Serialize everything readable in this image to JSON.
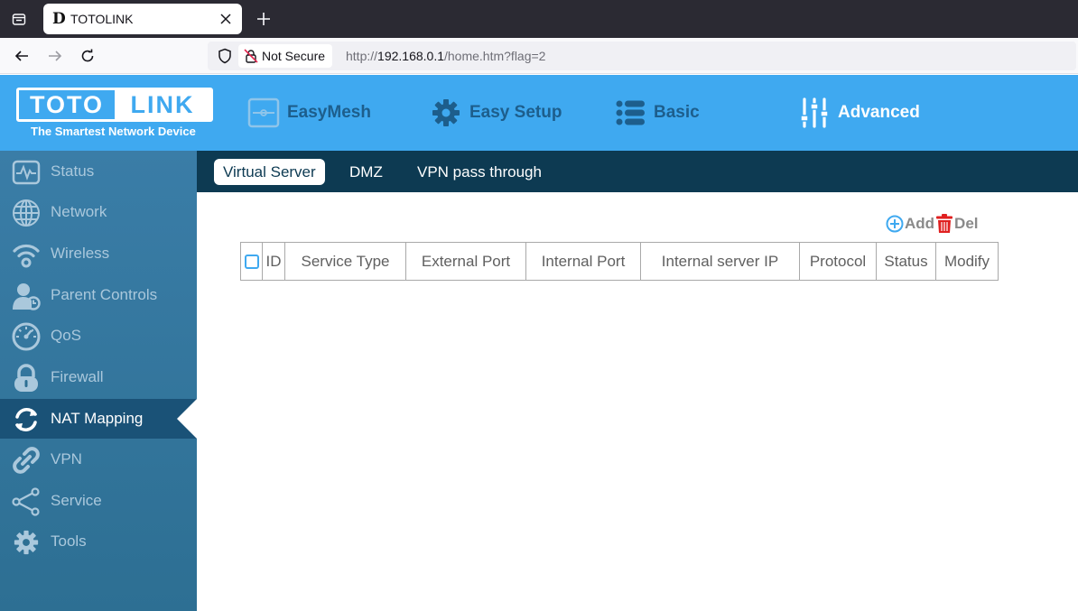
{
  "browser": {
    "tab_title": "TOTOLINK",
    "tab_favicon": "D",
    "security_label": "Not Secure",
    "url_prefix": "http://",
    "url_host": "192.168.0.1",
    "url_path": "/home.htm?flag=2"
  },
  "header": {
    "logo_left": "TOTO",
    "logo_right": "LINK",
    "tagline": "The Smartest Network Device",
    "nav": [
      {
        "label": "EasyMesh",
        "icon": "router-icon"
      },
      {
        "label": "Easy Setup",
        "icon": "gear-icon"
      },
      {
        "label": "Basic",
        "icon": "list-icon"
      },
      {
        "label": "Advanced",
        "icon": "sliders-icon"
      }
    ],
    "active_nav": "Advanced"
  },
  "sidebar": {
    "items": [
      {
        "label": "Status",
        "icon": "pulse-icon"
      },
      {
        "label": "Network",
        "icon": "globe-icon"
      },
      {
        "label": "Wireless",
        "icon": "wifi-icon"
      },
      {
        "label": "Parent Controls",
        "icon": "person-icon"
      },
      {
        "label": "QoS",
        "icon": "gauge-icon"
      },
      {
        "label": "Firewall",
        "icon": "lock-icon"
      },
      {
        "label": "NAT Mapping",
        "icon": "refresh-icon"
      },
      {
        "label": "VPN",
        "icon": "link-icon"
      },
      {
        "label": "Service",
        "icon": "share-icon"
      },
      {
        "label": "Tools",
        "icon": "cog-icon"
      }
    ],
    "active": "NAT Mapping"
  },
  "subnav": {
    "tabs": [
      "Virtual Server",
      "DMZ",
      "VPN pass through"
    ],
    "active": "Virtual Server"
  },
  "toolbar": {
    "add_label": "Add",
    "del_label": "Del"
  },
  "table": {
    "columns": [
      "ID",
      "Service Type",
      "External Port",
      "Internal Port",
      "Internal server IP",
      "Protocol",
      "Status",
      "Modify"
    ],
    "rows": []
  },
  "colors": {
    "header_blue": "#3fa9f0",
    "sidebar_blue": "#2d6f93",
    "subnav_dark": "#0d3a52",
    "delete_red": "#e02020"
  }
}
